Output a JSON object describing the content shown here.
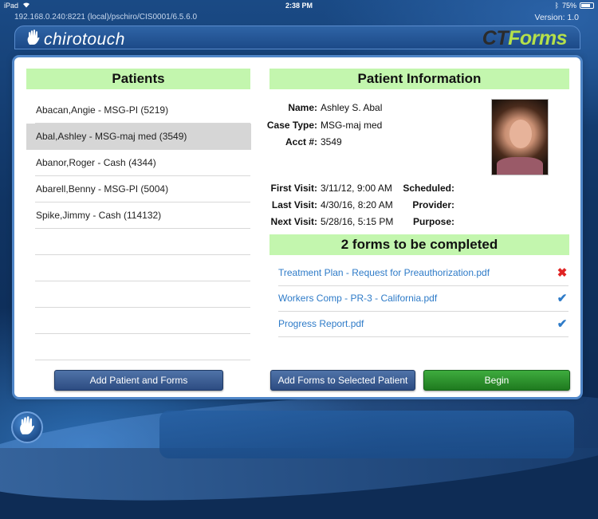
{
  "status_bar": {
    "device": "iPad",
    "time": "2:38 PM",
    "battery_text": "75%",
    "battery_level": 0.75
  },
  "app": {
    "url": "192.168.0.240:8221 (local)/pschiro/CIS0001/6.5.6.0",
    "version": "Version: 1.0",
    "logo_left": "chirotouch",
    "logo_right_ct": "CT",
    "logo_right_forms": "Forms"
  },
  "patients": {
    "title": "Patients",
    "items": [
      {
        "label": "Abacan,Angie - MSG-PI (5219)",
        "selected": false
      },
      {
        "label": "Abal,Ashley - MSG-maj med (3549)",
        "selected": true
      },
      {
        "label": "Abanor,Roger - Cash (4344)",
        "selected": false
      },
      {
        "label": "Abarell,Benny - MSG-PI (5004)",
        "selected": false
      },
      {
        "label": "Spike,Jimmy - Cash (114132)",
        "selected": false
      },
      {
        "label": "",
        "selected": false
      },
      {
        "label": "",
        "selected": false
      },
      {
        "label": "",
        "selected": false
      },
      {
        "label": "",
        "selected": false
      },
      {
        "label": "",
        "selected": false
      }
    ],
    "add_button": "Add Patient and Forms"
  },
  "patient_info": {
    "title": "Patient Information",
    "name_label": "Name:",
    "name": "Ashley S. Abal",
    "case_type_label": "Case Type:",
    "case_type": "MSG-maj med",
    "acct_label": "Acct #:",
    "acct": "3549",
    "first_visit_label": "First Visit:",
    "first_visit": "3/11/12, 9:00 AM",
    "last_visit_label": "Last Visit:",
    "last_visit": "4/30/16, 8:20 AM",
    "next_visit_label": "Next Visit:",
    "next_visit": "5/28/16, 5:15 PM",
    "scheduled_label": "Scheduled:",
    "provider_label": "Provider:",
    "purpose_label": "Purpose:"
  },
  "forms": {
    "title": "2 forms to be completed",
    "items": [
      {
        "label": "Treatment Plan - Request for Preauthorization.pdf",
        "status": "✖",
        "status_color": "#e02424"
      },
      {
        "label": "Workers Comp - PR-3 - California.pdf",
        "status": "✔",
        "status_color": "#2e7bc8"
      },
      {
        "label": "Progress Report.pdf",
        "status": "✔",
        "status_color": "#2e7bc8"
      }
    ],
    "add_button": "Add Forms to Selected Patient",
    "begin_button": "Begin"
  }
}
